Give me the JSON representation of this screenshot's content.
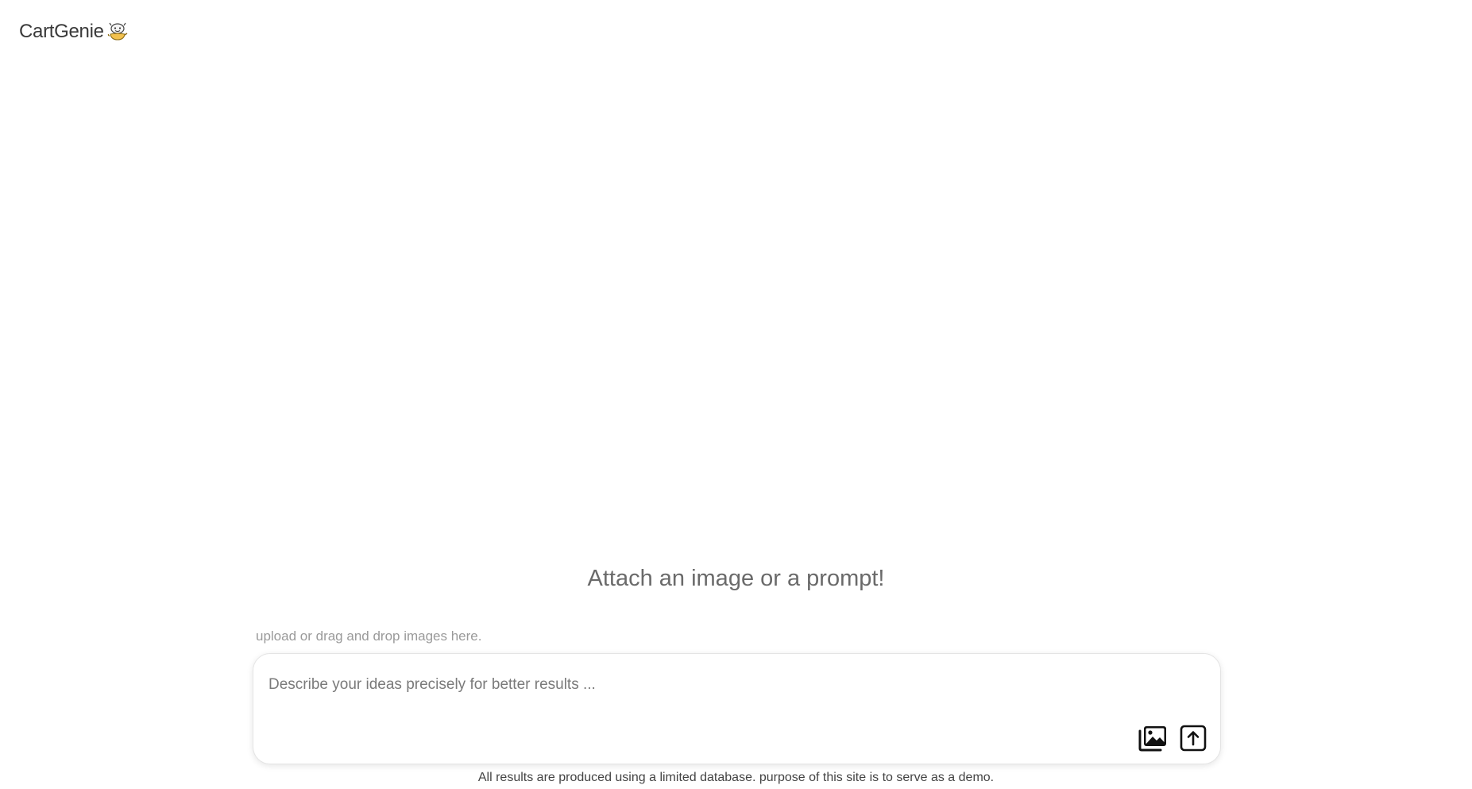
{
  "app": {
    "brand_name": "CartGenie",
    "logo_icon": "genie-lamp-icon"
  },
  "main": {
    "headline": "Attach an image or a prompt!",
    "upload_hint": "upload or drag and drop images here."
  },
  "prompt": {
    "placeholder": "Describe your ideas precisely for better results ...",
    "value": "",
    "attach_icon": "image-gallery-icon",
    "send_icon": "upload-arrow-icon"
  },
  "footer": {
    "disclaimer": "All results are produced using a limited database. purpose of this site is to serve as a demo."
  }
}
